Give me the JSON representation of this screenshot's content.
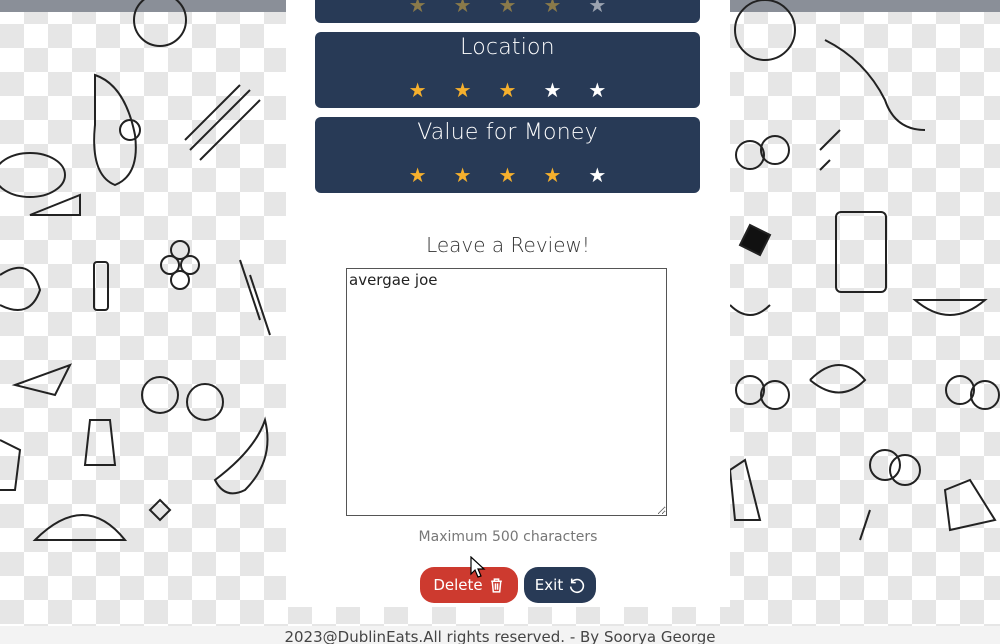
{
  "ratings": [
    {
      "label": "",
      "stars": [
        true,
        true,
        true,
        true,
        false
      ]
    },
    {
      "label": "Location",
      "stars": [
        true,
        true,
        true,
        false,
        false
      ]
    },
    {
      "label": "Value for Money",
      "stars": [
        true,
        true,
        true,
        true,
        false
      ]
    }
  ],
  "review": {
    "title": "Leave a Review!",
    "text": "avergae joe",
    "max_note": "Maximum 500 characters"
  },
  "buttons": {
    "delete_label": "Delete",
    "exit_label": "Exit"
  },
  "footer": {
    "text": "2023@DublinEats.All rights reserved. - By Soorya George"
  },
  "colors": {
    "panel_blue": "#283a56",
    "star_on": "#f6b02d",
    "star_off": "#ffffff",
    "delete_red": "#cd3a2f"
  },
  "icons": [
    "star-icon",
    "trash-icon",
    "refresh-icon",
    "cursor-icon"
  ]
}
